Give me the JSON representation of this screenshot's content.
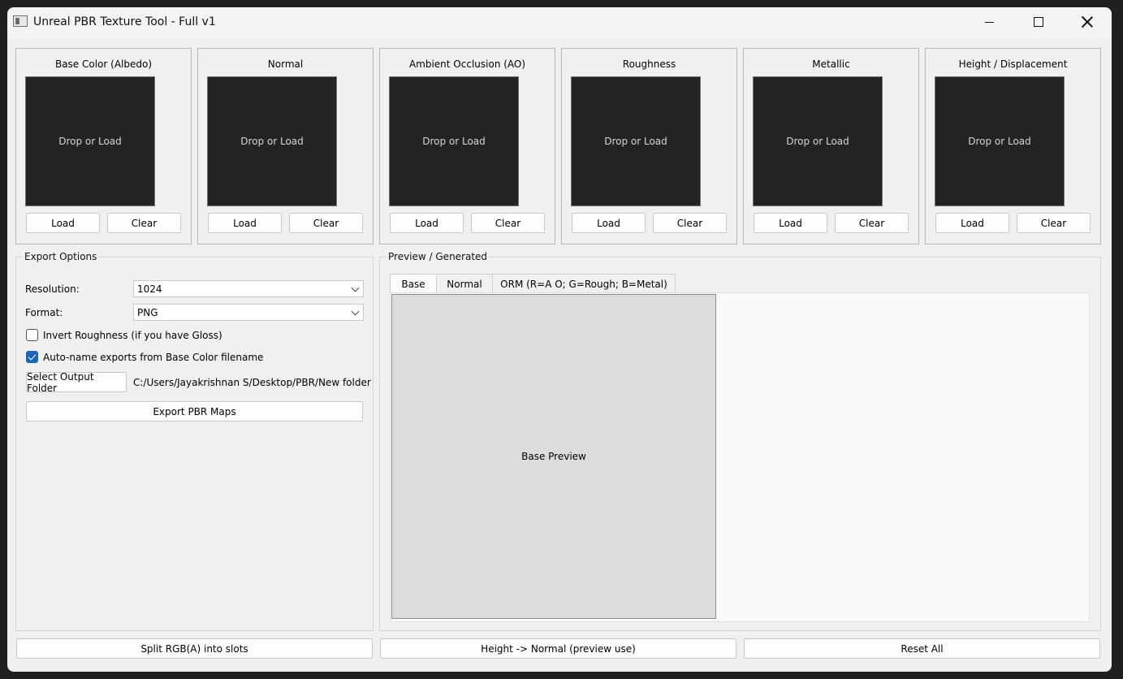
{
  "window": {
    "title": "Unreal PBR Texture Tool - Full v1"
  },
  "slots": [
    {
      "title": "Base Color (Albedo)",
      "placeholder": "Drop or Load",
      "load_label": "Load",
      "clear_label": "Clear"
    },
    {
      "title": "Normal",
      "placeholder": "Drop or Load",
      "load_label": "Load",
      "clear_label": "Clear"
    },
    {
      "title": "Ambient Occlusion (AO)",
      "placeholder": "Drop or Load",
      "load_label": "Load",
      "clear_label": "Clear"
    },
    {
      "title": "Roughness",
      "placeholder": "Drop or Load",
      "load_label": "Load",
      "clear_label": "Clear"
    },
    {
      "title": "Metallic",
      "placeholder": "Drop or Load",
      "load_label": "Load",
      "clear_label": "Clear"
    },
    {
      "title": "Height / Displacement",
      "placeholder": "Drop or Load",
      "load_label": "Load",
      "clear_label": "Clear"
    }
  ],
  "export": {
    "title": "Export Options",
    "resolution_label": "Resolution:",
    "resolution_value": "1024",
    "format_label": "Format:",
    "format_value": "PNG",
    "invert_label": "Invert Roughness (if you have Gloss)",
    "invert_checked": false,
    "autoname_label": "Auto-name exports from Base Color filename",
    "autoname_checked": true,
    "select_folder_label": "Select Output Folder",
    "folder_path": "C:/Users/Jayakrishnan S/Desktop/PBR/New folder",
    "export_label": "Export PBR Maps"
  },
  "preview": {
    "title": "Preview / Generated",
    "tabs": [
      {
        "label": "Base",
        "active": true
      },
      {
        "label": "Normal",
        "active": false
      },
      {
        "label": "ORM (R=A O; G=Rough; B=Metal)",
        "active": false
      }
    ],
    "base_preview_label": "Base Preview"
  },
  "bottom": {
    "split_label": "Split RGB(A) into slots",
    "height_normal_label": "Height -> Normal (preview  use)",
    "reset_label": "Reset All"
  },
  "colors": {
    "accent": "#1a66b8",
    "drop_bg": "#232323",
    "preview_bg": "#dcdcdc"
  }
}
